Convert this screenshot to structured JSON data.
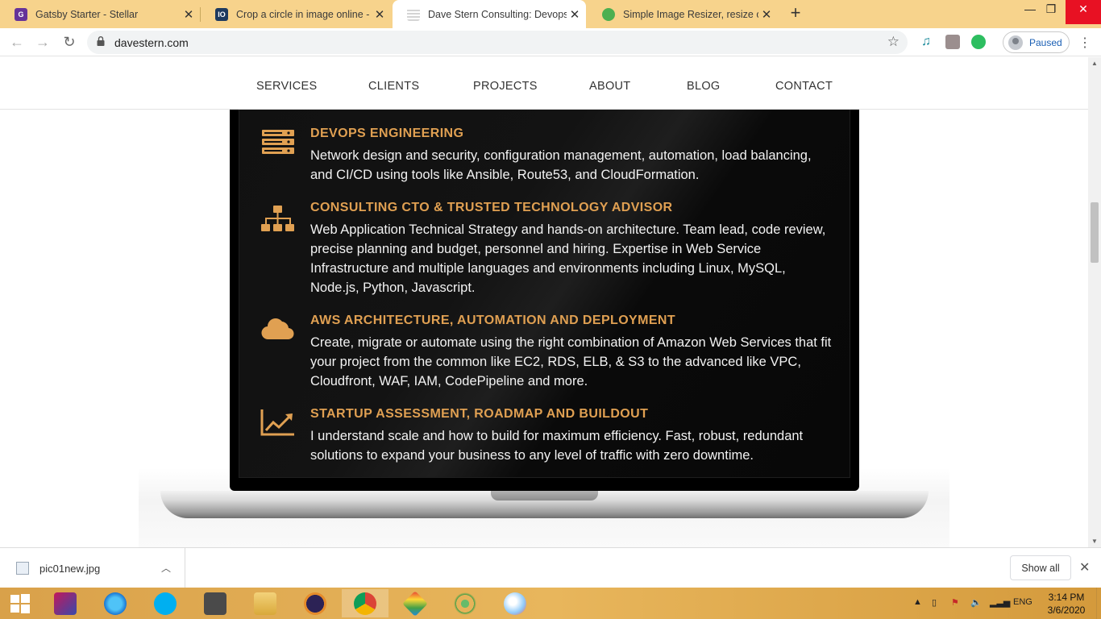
{
  "browser": {
    "tabs": [
      {
        "title": "Gatsby Starter - Stellar",
        "favicon_color": "#663399",
        "favicon_glyph": "G",
        "active": false
      },
      {
        "title": "Crop a circle in image online - fre",
        "favicon_color": "#1e3a5f",
        "favicon_glyph": "IO",
        "active": false
      },
      {
        "title": "Dave Stern Consulting: Devops E",
        "favicon_color": "#cfcfcf",
        "favicon_glyph": "",
        "active": true
      },
      {
        "title": "Simple Image Resizer, resize onli",
        "favicon_color": "#4caf50",
        "favicon_glyph": "",
        "active": false
      }
    ],
    "new_tab_label": "+",
    "url": "davestern.com",
    "profile_status": "Paused"
  },
  "site": {
    "nav": [
      "SERVICES",
      "CLIENTS",
      "PROJECTS",
      "ABOUT",
      "BLOG",
      "CONTACT"
    ],
    "services": [
      {
        "icon": "server-icon",
        "title": "DEVOPS ENGINEERING",
        "text": "Network design and security, configuration management, automation, load balancing, and CI/CD using tools like Ansible, Route53, and CloudFormation."
      },
      {
        "icon": "sitemap-icon",
        "title": "CONSULTING CTO & TRUSTED TECHNOLOGY ADVISOR",
        "text": "Web Application Technical Strategy and hands-on architecture. Team lead, code review, precise planning and budget, personnel and hiring. Expertise in Web Service Infrastructure and multiple languages and environments including Linux, MySQL, Node.js, Python, Javascript."
      },
      {
        "icon": "cloud-icon",
        "title": "AWS ARCHITECTURE, AUTOMATION AND DEPLOYMENT",
        "text": "Create, migrate or automate using the right combination of Amazon Web Services that fit your project from the common like EC2, RDS, ELB, & S3 to the advanced like VPC, Cloudfront, WAF, IAM, CodePipeline and more."
      },
      {
        "icon": "line-chart-icon",
        "title": "STARTUP ASSESSMENT, ROADMAP AND BUILDOUT",
        "text": "I understand scale and how to build for maximum efficiency. Fast, robust, redundant solutions to expand your business to any level of traffic with zero downtime."
      }
    ],
    "accent_color": "#e0a052"
  },
  "downloads": {
    "file_name": "pic01new.jpg",
    "show_all_label": "Show all"
  },
  "taskbar": {
    "language": "ENG",
    "time": "3:14 PM",
    "date": "3/6/2020"
  }
}
